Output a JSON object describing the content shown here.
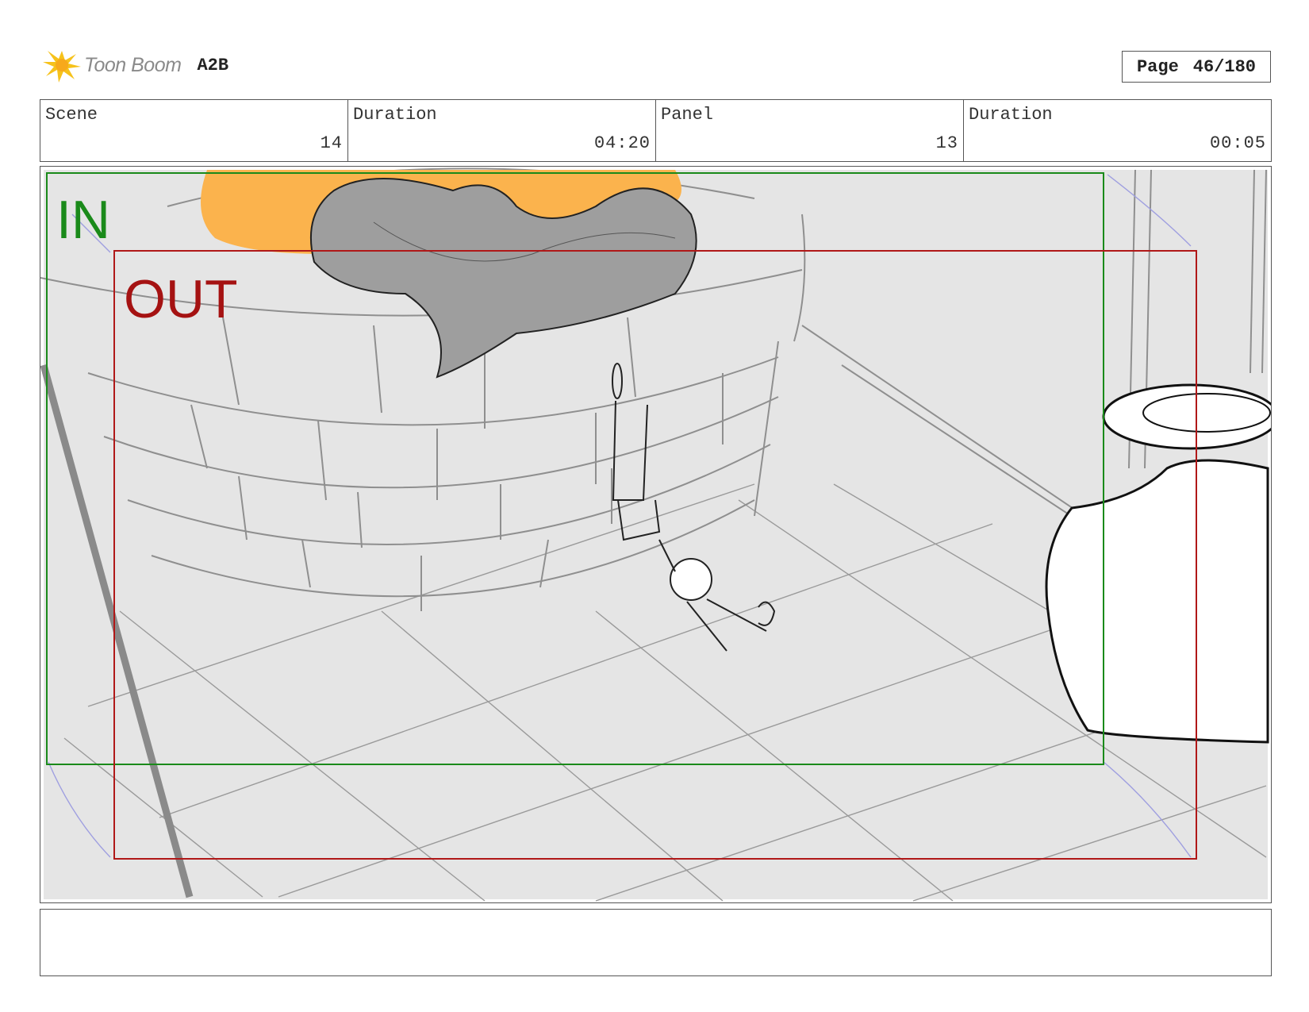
{
  "header": {
    "brand": "Toon Boom",
    "project": "A2B",
    "page_label": "Page",
    "page_number": "46/180"
  },
  "info": {
    "scene_label": "Scene",
    "scene_value": "14",
    "scene_duration_label": "Duration",
    "scene_duration_value": "04:20",
    "panel_label": "Panel",
    "panel_value": "13",
    "panel_duration_label": "Duration",
    "panel_duration_value": "00:05"
  },
  "frame": {
    "in_label": "IN",
    "out_label": "OUT",
    "in_color": "#1a8a1a",
    "out_color": "#b01818"
  },
  "notes": {
    "text": ""
  }
}
